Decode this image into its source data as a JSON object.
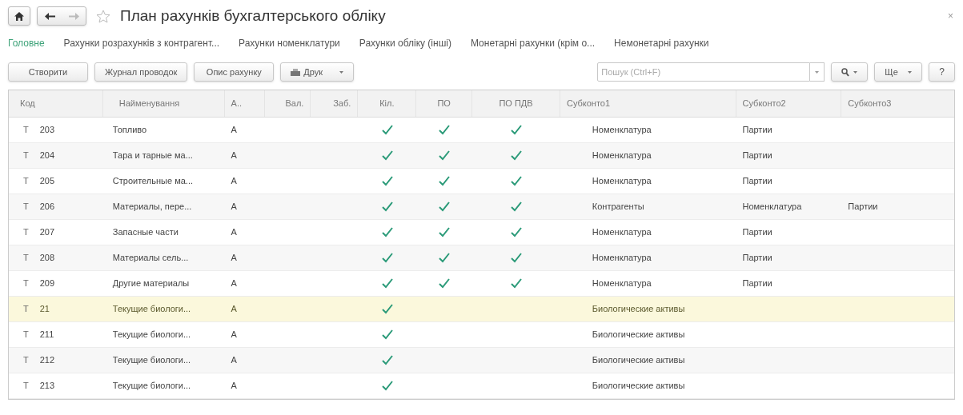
{
  "window": {
    "title": "План рахунків бухгалтерського обліку",
    "close": "×"
  },
  "tabs": [
    {
      "label": "Головне",
      "selected": true
    },
    {
      "label": "Рахунки розрахунків з контрагент...",
      "selected": false
    },
    {
      "label": "Рахунки номенклатури",
      "selected": false
    },
    {
      "label": "Рахунки обліку (інші)",
      "selected": false
    },
    {
      "label": "Монетарні рахунки (крім о...",
      "selected": false
    },
    {
      "label": "Немонетарні рахунки",
      "selected": false
    }
  ],
  "toolbar": {
    "buttons": [
      "Створити",
      "Журнал проводок",
      "Опис рахунку"
    ],
    "print": "Друк",
    "search": {
      "placeholder": "Пошук (Ctrl+F)"
    },
    "more": "Ще",
    "help": "?"
  },
  "table": {
    "columns": [
      "Код",
      "Найменування",
      "А..",
      "Вал.",
      "Заб.",
      "Кіл.",
      "ПО",
      "ПО ПДВ",
      "Субконто1",
      "Субконто2",
      "Субконто3"
    ],
    "rows": [
      {
        "mark": "Т",
        "code": "203",
        "name": "Топливо",
        "type": "А",
        "qty": true,
        "po": true,
        "po_vat": true,
        "sub1": "Номенклатура",
        "sub2": "Партии",
        "selected": false
      },
      {
        "mark": "Т",
        "code": "204",
        "name": "Тара и тарные ма...",
        "type": "А",
        "qty": true,
        "po": true,
        "po_vat": true,
        "sub1": "Номенклатура",
        "sub2": "Партии",
        "selected": false
      },
      {
        "mark": "Т",
        "code": "205",
        "name": "Строительные ма...",
        "type": "А",
        "qty": true,
        "po": true,
        "po_vat": true,
        "sub1": "Номенклатура",
        "sub2": "Партии",
        "selected": false
      },
      {
        "mark": "Т",
        "code": "206",
        "name": "Материалы, пере...",
        "type": "А",
        "qty": true,
        "po": true,
        "po_vat": true,
        "sub1": "Контрагенты",
        "sub2": "Номенклатура",
        "sub3": "Партии",
        "selected": false
      },
      {
        "mark": "Т",
        "code": "207",
        "name": "Запасные части",
        "type": "А",
        "qty": true,
        "po": true,
        "po_vat": true,
        "sub1": "Номенклатура",
        "sub2": "Партии",
        "selected": false
      },
      {
        "mark": "Т",
        "code": "208",
        "name": "Материалы сель...",
        "type": "А",
        "qty": true,
        "po": true,
        "po_vat": true,
        "sub1": "Номенклатура",
        "sub2": "Партии",
        "selected": false
      },
      {
        "mark": "Т",
        "code": "209",
        "name": "Другие материалы",
        "type": "А",
        "qty": true,
        "po": true,
        "po_vat": true,
        "sub1": "Номенклатура",
        "sub2": "Партии",
        "selected": false
      },
      {
        "mark": "Т",
        "code": "21",
        "name": "Текущие биологи...",
        "type": "А",
        "qty": true,
        "po": false,
        "po_vat": false,
        "sub1": "Биологические активы",
        "selected": true
      },
      {
        "mark": "Т",
        "code": "211",
        "name": "Текущие биологи...",
        "type": "А",
        "qty": true,
        "po": false,
        "po_vat": false,
        "sub1": "Биологические активы",
        "selected": false
      },
      {
        "mark": "Т",
        "code": "212",
        "name": "Текущие биологи...",
        "type": "А",
        "qty": true,
        "po": false,
        "po_vat": false,
        "sub1": "Биологические активы",
        "selected": false
      },
      {
        "mark": "Т",
        "code": "213",
        "name": "Текущие биологи...",
        "type": "А",
        "qty": true,
        "po": false,
        "po_vat": false,
        "sub1": "Биологические активы",
        "selected": false
      }
    ]
  }
}
